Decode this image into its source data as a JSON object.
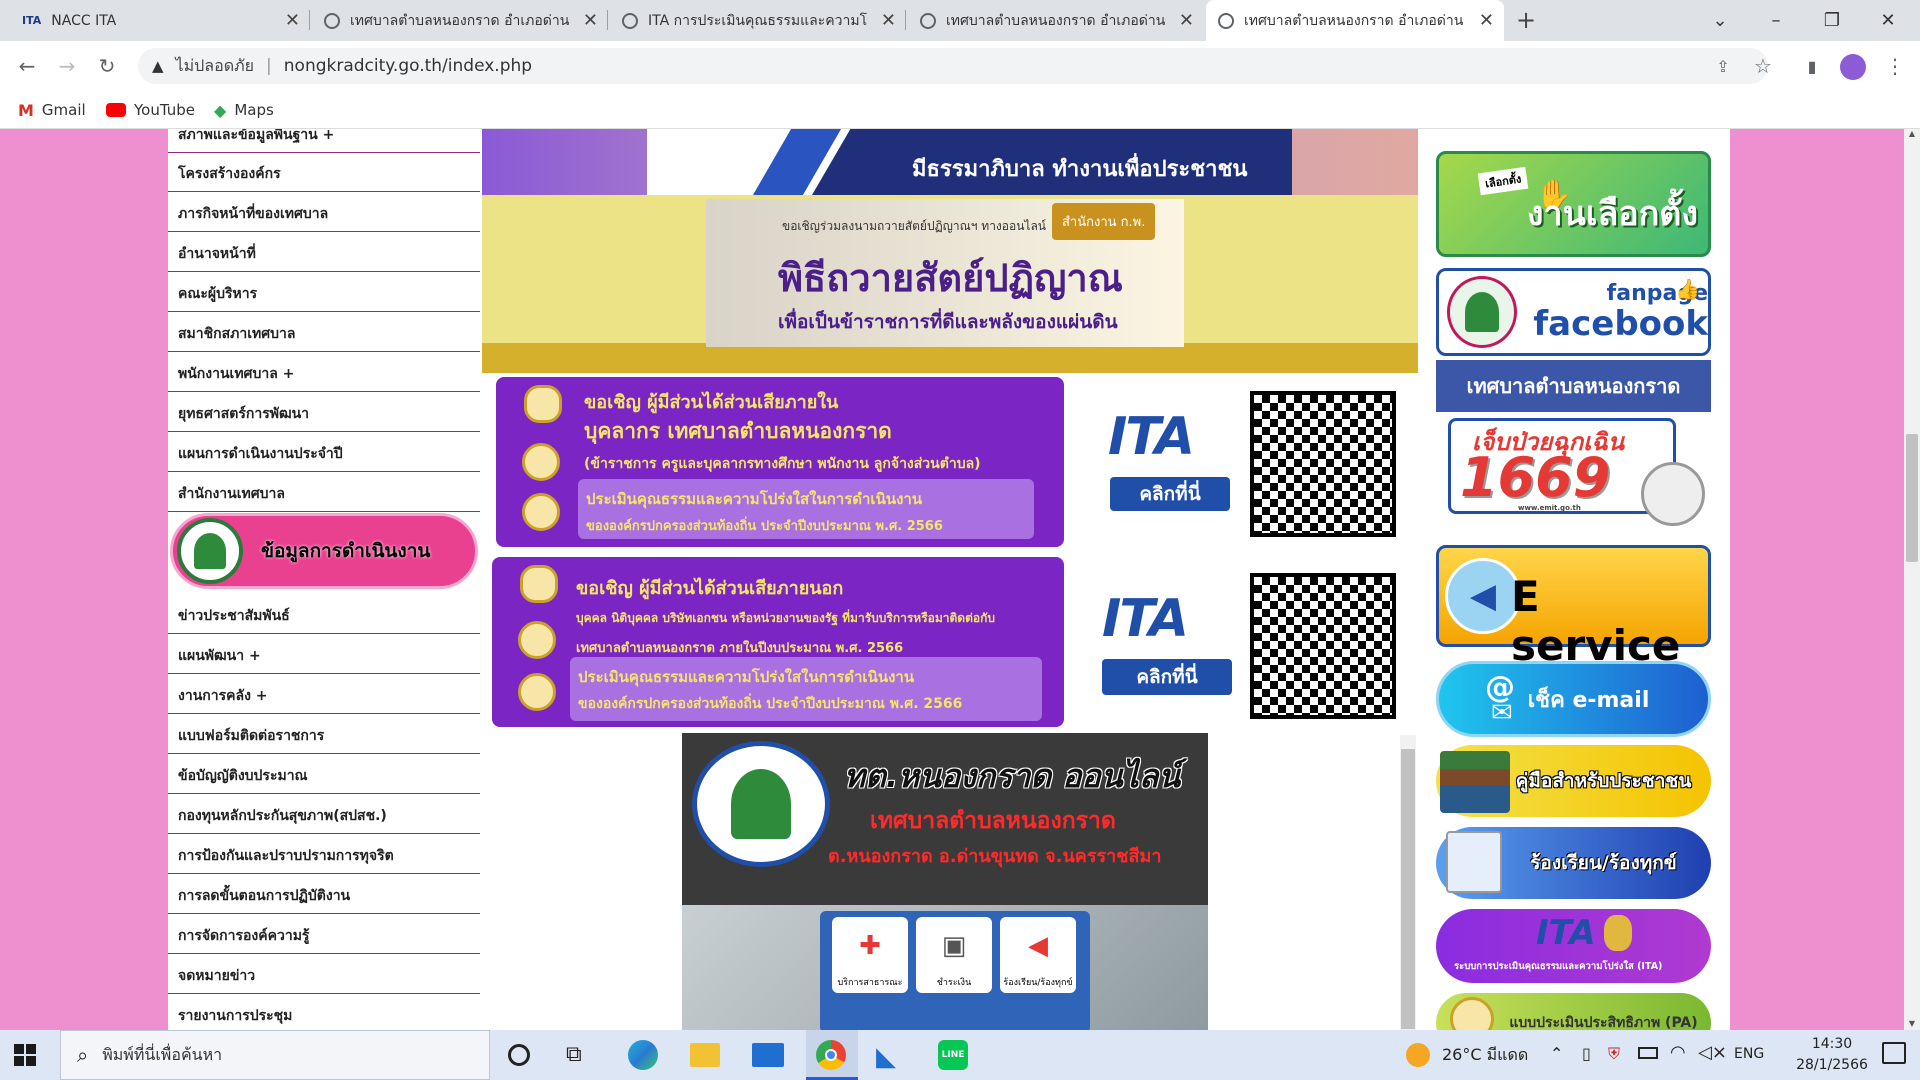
{
  "tabs": [
    {
      "title": "NACC ITA",
      "active": false
    },
    {
      "title": "เทศบาลตำบลหนองกราด อำเภอด่านขุนทด",
      "active": false
    },
    {
      "title": "ITA การประเมินคุณธรรมและความโปร่งใส",
      "active": false
    },
    {
      "title": "เทศบาลตำบลหนองกราด อำเภอด่านขุนทด",
      "active": false
    },
    {
      "title": "เทศบาลตำบลหนองกราด อำเภอด่านขุนทด",
      "active": true
    }
  ],
  "browser": {
    "security_label": "ไม่ปลอดภัย",
    "url": "nongkradcity.go.th/index.php",
    "bookmarks": [
      "Gmail",
      "YouTube",
      "Maps"
    ]
  },
  "sidebar": {
    "items_top": [
      "สภาพและข้อมูลพื้นฐาน +",
      "โครงสร้างองค์กร",
      "ภารกิจหน้าที่ของเทศบาล",
      "อำนาจหน้าที่",
      "คณะผู้บริหาร",
      "สมาชิกสภาเทศบาล",
      "พนักงานเทศบาล +",
      "ยุทธศาสตร์การพัฒนา",
      "แผนการดำเนินงานประจำปี",
      "สำนักงานเทศบาล"
    ],
    "section_header": "ข้อมูลการดำเนินงาน",
    "items_bottom": [
      "ข่าวประชาสัมพันธ์",
      "แผนพัฒนา +",
      "งานการคลัง +",
      "แบบฟอร์มติดต่อราชการ",
      "ข้อบัญญัติงบประมาณ",
      "กองทุนหลักประกันสุขภาพ(สปสช.)",
      "การป้องกันและปราบปรามการทุจริต",
      "การลดขั้นตอนการปฏิบัติงาน",
      "การจัดการองค์ความรู้",
      "จดหมายข่าว",
      "รายงานการประชุม"
    ]
  },
  "center": {
    "top_banner_text": "มีธรรมาภิบาล ทำงานเพื่อประชาชน",
    "oath": {
      "invite": "ขอเชิญร่วมลงนามถวายสัตย์ปฏิญาณฯ ทางออนไลน์",
      "org": "สำนักงาน ก.พ.",
      "title": "พิธีถวายสัตย์ปฏิญาณ",
      "subtitle": "เพื่อเป็นข้าราชการที่ดีและพลังของแผ่นดิน"
    },
    "ita_internal": {
      "line1": "ขอเชิญ ผู้มีส่วนได้ส่วนเสียภายใน",
      "line2": "บุคลากร เทศบาลตำบลหนองกราด",
      "line3": "(ข้าราชการ ครูและบุคลากรทางศึกษา พนักงาน ลูกจ้างส่วนตำบล)",
      "line4": "ประเมินคุณธรรมและความโปร่งใสในการดำเนินงาน",
      "line5": "ขององค์กรปกครองส่วนท้องถิ่น ประจำปีงบประมาณ พ.ศ. 2566"
    },
    "ita_external": {
      "line1": "ขอเชิญ ผู้มีส่วนได้ส่วนเสียภายนอก",
      "line2": "บุคคล นิติบุคคล บริษัทเอกชน หรือหน่วยงานของรัฐ ที่มารับบริการหรือมาติดต่อกับ",
      "line3": "เทศบาลตำบลหนองกราด ภายในปีงบประมาณ พ.ศ. 2566",
      "line4": "ประเมินคุณธรรมและความโปร่งใสในการดำเนินงาน",
      "line5": "ขององค์กรปกครองส่วนท้องถิ่น ประจำปีงบประมาณ พ.ศ. 2566"
    },
    "ita_logo": "ITA",
    "ita_click": "คลิกที่นี่",
    "online": {
      "title": "ทต.หนองกราด ออนไลน์",
      "subtitle": "เทศบาลตำบลหนองกราด",
      "address": "ต.หนองกราด อ.ด่านขุนทด จ.นครราชสีมา",
      "services": [
        "บริการสาธารณะ",
        "ชำระเงิน",
        "ร้องเรียน/ร้องทุกข์"
      ]
    }
  },
  "right": {
    "election_small": "เลือกตั้ง",
    "election": "งานเลือกตั้ง",
    "fanpage": "fanpage",
    "facebook": "facebook",
    "muni_name": "เทศบาลตำบลหนองกราด",
    "emergency": "เจ็บป่วยฉุกเฉิน",
    "emergency_number": "1669",
    "emergency_url": "www.emit.go.th",
    "eservice": "E service",
    "email": "เช็ค e-mail",
    "manual": "คู่มือสำหรับประชาชน",
    "complaint": "ร้องเรียน/ร้องทุกข์",
    "ita_system": "ระบบการประเมินคุณธรรมและความโปร่งใส (ITA)",
    "pa": "แบบประเมินประสิทธิภาพ (PA)"
  },
  "taskbar": {
    "search_placeholder": "พิมพ์ที่นี่เพื่อค้นหา",
    "weather": "26°C มีแดด",
    "lang": "ENG",
    "time": "14:30",
    "date": "28/1/2566"
  },
  "colors": {
    "page_bg": "#ee8fcf",
    "purple": "#7b25c4",
    "menu_border": "#8a2b7e"
  }
}
